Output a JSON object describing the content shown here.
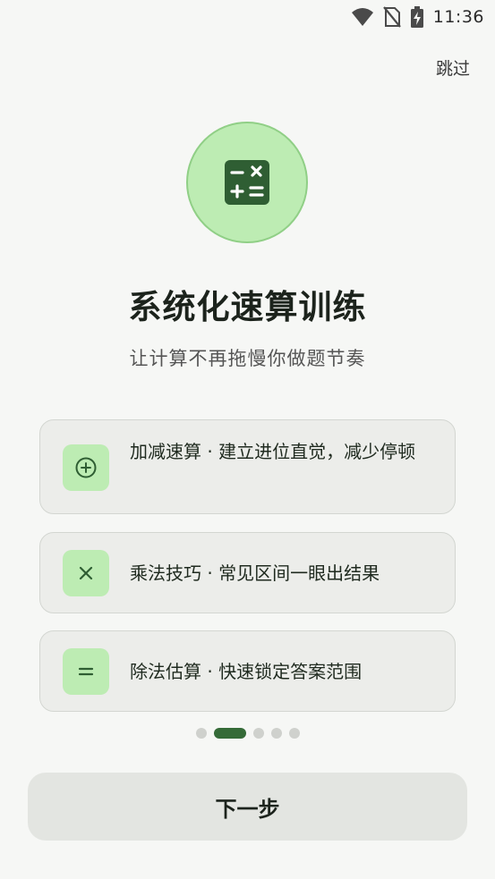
{
  "status_bar": {
    "time": "11:36"
  },
  "header": {
    "skip_label": "跳过"
  },
  "hero": {
    "icon": "calculator-icon"
  },
  "title": "系统化速算训练",
  "subtitle": "让计算不再拖慢你做题节奏",
  "features": [
    {
      "icon": "plus-circle-icon",
      "text": "加减速算 · 建立进位直觉，减少停顿"
    },
    {
      "icon": "multiply-icon",
      "text": "乘法技巧 · 常见区间一眼出结果"
    },
    {
      "icon": "equals-icon",
      "text": "除法估算 · 快速锁定答案范围"
    }
  ],
  "pagination": {
    "total": 5,
    "current": 2
  },
  "next_button_label": "下一步",
  "colors": {
    "accent": "#356b38",
    "accent_light": "#bdecb3",
    "card_bg": "#ecedea"
  }
}
